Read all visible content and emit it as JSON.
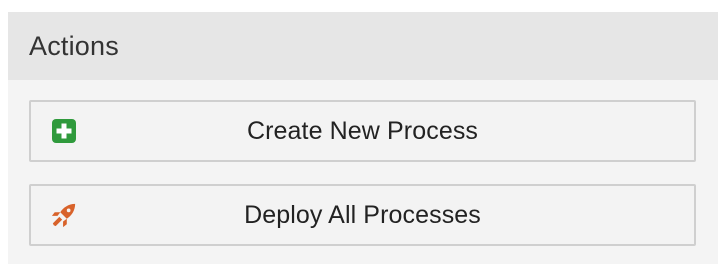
{
  "panel": {
    "title": "Actions"
  },
  "actions": [
    {
      "label": "Create New Process",
      "icon": "plus-square-icon",
      "icon_color": "#2f9a3c"
    },
    {
      "label": "Deploy All Processes",
      "icon": "rocket-icon",
      "icon_color": "#d8622a"
    }
  ]
}
